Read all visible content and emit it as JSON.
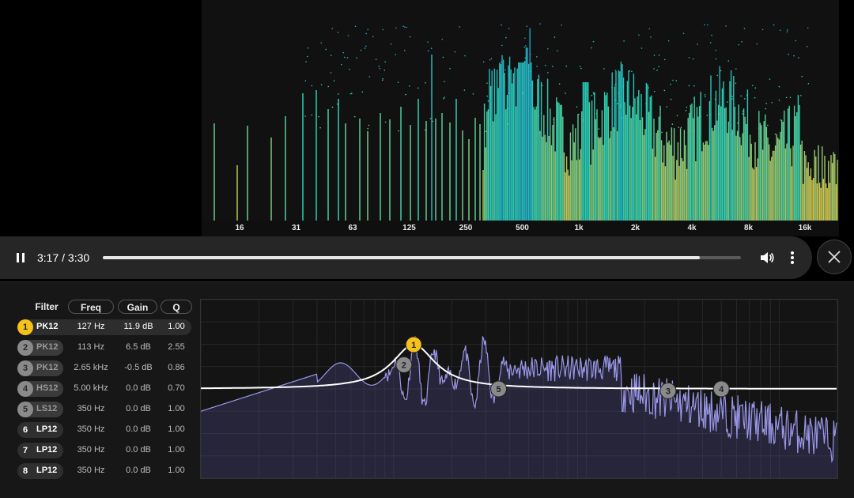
{
  "spectrum": {
    "freq_ticks": [
      "16",
      "31",
      "63",
      "125",
      "250",
      "500",
      "1k",
      "2k",
      "4k",
      "8k",
      "16k"
    ]
  },
  "player": {
    "time": "3:17 / 3:30",
    "progress": 0.936
  },
  "eq_table": {
    "headers": {
      "filter": "Filter",
      "freq": "Freq",
      "gain": "Gain",
      "q": "Q"
    },
    "rows": [
      {
        "num": "1",
        "type": "PK12",
        "freq": "127 Hz",
        "gain": "11.9 dB",
        "q": "1.00",
        "state": "active",
        "freq_hz": 127,
        "gain_db": 11.9,
        "q_val": 1.0
      },
      {
        "num": "2",
        "type": "PK12",
        "freq": "113 Hz",
        "gain": "6.5 dB",
        "q": "2.55",
        "state": "dim",
        "freq_hz": 113,
        "gain_db": 6.5,
        "q_val": 2.55
      },
      {
        "num": "3",
        "type": "PK12",
        "freq": "2.65 kHz",
        "gain": "-0.5 dB",
        "q": "0.86",
        "state": "dim",
        "freq_hz": 2650,
        "gain_db": -0.5,
        "q_val": 0.86
      },
      {
        "num": "4",
        "type": "HS12",
        "freq": "5.00 kHz",
        "gain": "0.0 dB",
        "q": "0.70",
        "state": "dim",
        "freq_hz": 5000,
        "gain_db": 0,
        "q_val": 0.7
      },
      {
        "num": "5",
        "type": "LS12",
        "freq": "350 Hz",
        "gain": "0.0 dB",
        "q": "1.00",
        "state": "dim",
        "freq_hz": 350,
        "gain_db": 0,
        "q_val": 1.0
      },
      {
        "num": "6",
        "type": "LP12",
        "freq": "350 Hz",
        "gain": "0.0 dB",
        "q": "1.00",
        "state": "off"
      },
      {
        "num": "7",
        "type": "LP12",
        "freq": "350 Hz",
        "gain": "0.0 dB",
        "q": "1.00",
        "state": "off"
      },
      {
        "num": "8",
        "type": "LP12",
        "freq": "350 Hz",
        "gain": "0.0 dB",
        "q": "1.00",
        "state": "off"
      }
    ]
  },
  "colors": {
    "accent": "#f5c21b",
    "curve": "#ffffff",
    "response": "#9a97e8",
    "spectrum_low": "#1a8fd8",
    "spectrum_mid": "#2cd0b0",
    "spectrum_high": "#e8c040"
  }
}
